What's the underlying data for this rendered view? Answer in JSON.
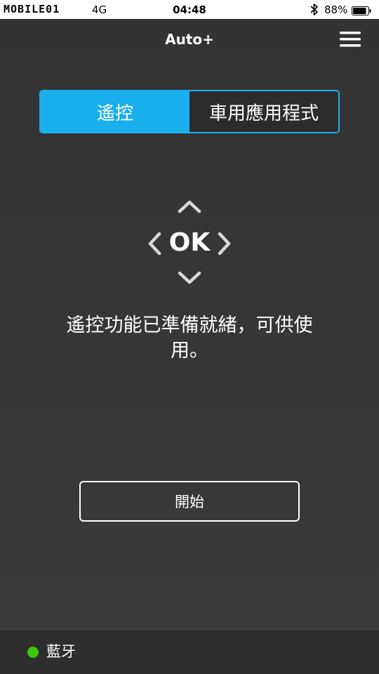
{
  "status_bar": {
    "carrier": "MOBILE01",
    "network": "4G",
    "time": "04:48",
    "bluetooth_icon": "bluetooth-icon",
    "battery_percent": "88%",
    "battery_level": 0.88
  },
  "header": {
    "title": "Auto+",
    "menu_icon": "hamburger-menu-icon"
  },
  "tabs": [
    {
      "label": "遙控",
      "active": true
    },
    {
      "label": "車用應用程式",
      "active": false
    }
  ],
  "dpad": {
    "center_label": "OK",
    "icons": [
      "chevron-up-icon",
      "chevron-left-icon",
      "chevron-right-icon",
      "chevron-down-icon"
    ]
  },
  "main": {
    "status_message": "遙控功能已準備就緒，可供使用。",
    "start_button_label": "開始"
  },
  "footer": {
    "connection_label": "藍牙",
    "connection_color": "#3ec40d"
  },
  "colors": {
    "accent": "#1aafef",
    "background": "#333333"
  }
}
